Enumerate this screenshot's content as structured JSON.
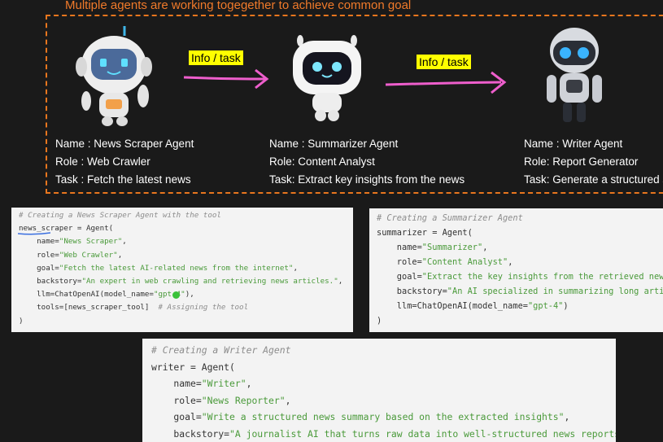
{
  "header": {
    "title": "Multiple agents are working togegether to achieve common goal"
  },
  "arrows": [
    {
      "label": "Info / task"
    },
    {
      "label": "Info / task"
    }
  ],
  "agents": [
    {
      "name": "Name : News Scraper Agent",
      "role": "Role :  Web Crawler",
      "task": "Task : Fetch the latest news"
    },
    {
      "name": "Name : Summarizer Agent",
      "role": "Role: Content Analyst",
      "task": "Task:  Extract key insights from the news"
    },
    {
      "name": "Name : Writer Agent",
      "role": "Role: Report Generator",
      "task": "Task: Generate a structured s"
    }
  ],
  "code_blocks": [
    {
      "comment": "# Creating a News Scraper Agent with the tool",
      "line1": "news_scraper = Agent(",
      "name_key": "    name=",
      "name_val": "\"News Scraper\"",
      "name_end": ",",
      "role_key": "    role=",
      "role_val": "\"Web Crawler\"",
      "role_end": ",",
      "goal_key": "    goal=",
      "goal_val": "\"Fetch the latest AI-related news from the internet\"",
      "goal_end": ",",
      "back_key": "    backstory=",
      "back_val": "\"An expert in web crawling and retrieving news articles.\"",
      "back_end": ",",
      "llm_key": "    llm=ChatOpenAI(model_name=",
      "llm_val": "\"gpt-4\"",
      "llm_end": "),",
      "tools": "    tools=[news_scraper_tool]  ",
      "tools_cm": "# Assigning the tool",
      "close": ")"
    },
    {
      "comment": "# Creating a Summarizer Agent",
      "line1": "summarizer = Agent(",
      "name_key": "    name=",
      "name_val": "\"Summarizer\"",
      "name_end": ",",
      "role_key": "    role=",
      "role_val": "\"Content Analyst\"",
      "role_end": ",",
      "goal_key": "    goal=",
      "goal_val": "\"Extract the key insights from the retrieved news ar",
      "goal_end": "",
      "back_key": "    backstory=",
      "back_val": "\"An AI specialized in summarizing long articles",
      "back_end": "",
      "llm_key": "    llm=ChatOpenAI(model_name=",
      "llm_val": "\"gpt-4\"",
      "llm_end": ")",
      "close": ")"
    },
    {
      "comment": "# Creating a Writer Agent",
      "line1": "writer = Agent(",
      "name_key": "    name=",
      "name_val": "\"Writer\"",
      "name_end": ",",
      "role_key": "    role=",
      "role_val": "\"News Reporter\"",
      "role_end": ",",
      "goal_key": "    goal=",
      "goal_val": "\"Write a structured news summary based on the extracted insights\"",
      "goal_end": ",",
      "back_key": "    backstory=",
      "back_val": "\"A journalist AI that turns raw data into well-structured news reports.\"",
      "back_end": ","
    }
  ]
}
